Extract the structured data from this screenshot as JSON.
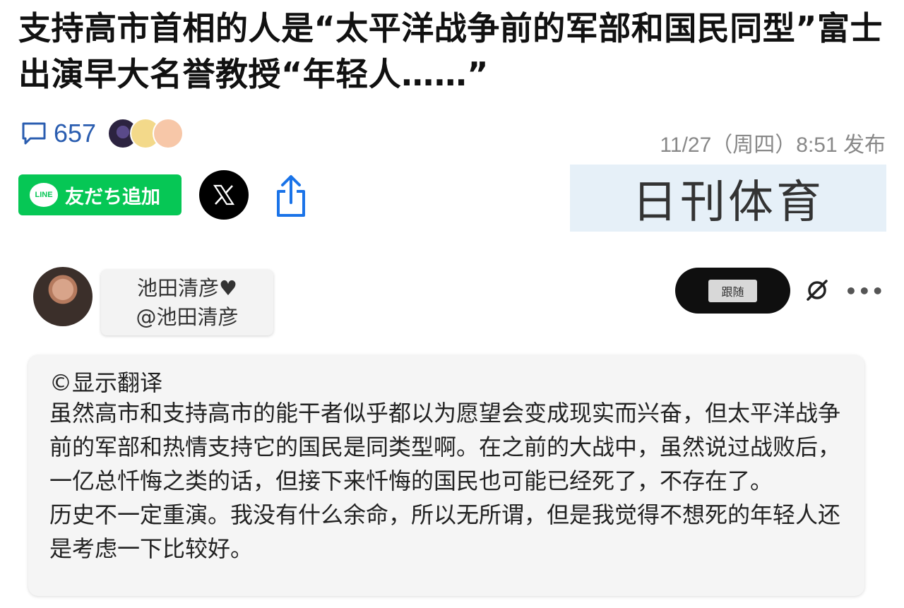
{
  "article": {
    "headline": "支持高市首相的人是“太平洋战争前的军部和国民同型”富士出演早大名誉教授“年轻人……”",
    "comment_count": "657",
    "timestamp": "11/27（周四）8:51 发布",
    "source_name": "日刊体育"
  },
  "share": {
    "line_logo_text": "LINE",
    "line_label": "友だち追加"
  },
  "tweet": {
    "display_name": "池田清彦♥",
    "handle": "@池田清彦",
    "follow_label": "跟随",
    "translate_label": "©显示翻译",
    "text": "虽然高市和支持高市的能干者似乎都以为愿望会变成现实而兴奋，但太平洋战争前的军部和热情支持它的国民是同类型啊。在之前的大战中，虽然说过战败后，一亿总忏悔之类的话，但接下来忏悔的国民也可能已经死了，不存在了。\n历史不一定重演。我没有什么余命，所以无所谓，但是我觉得不想死的年轻人还是考虑一下比较好。"
  },
  "icons": {
    "comment": "comment-icon",
    "share": "share-icon",
    "x": "x-logo-icon",
    "more": "more-icon"
  },
  "colors": {
    "line_green": "#06c755",
    "comment_blue": "#2a5db0",
    "source_bg": "#e6f0f8"
  }
}
